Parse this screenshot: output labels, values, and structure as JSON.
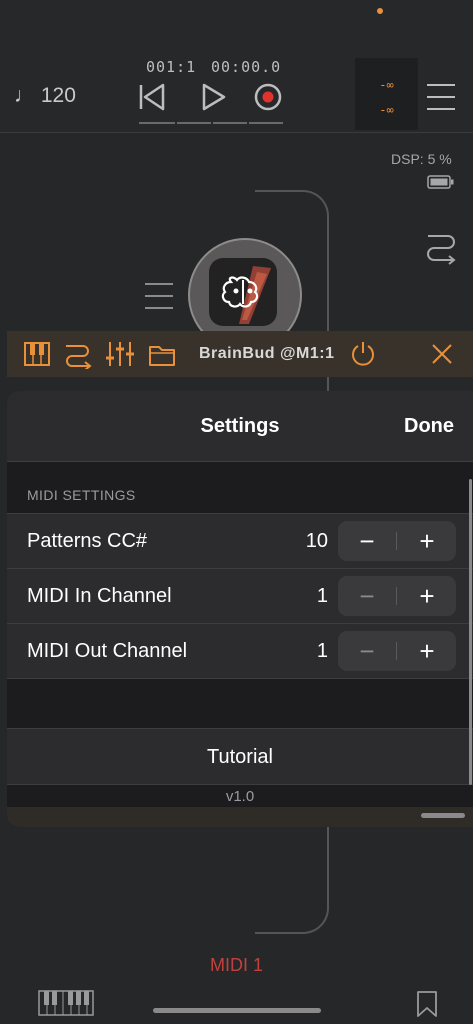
{
  "transport": {
    "tempo_icon": "note-icon",
    "tempo": "120",
    "bar_position": "001:1",
    "time_position": "00:00.0",
    "meter_top": "-∞",
    "meter_bottom": "-∞"
  },
  "status": {
    "dsp_label": "DSP:",
    "dsp_value": "5 %"
  },
  "plugin_bar": {
    "title": "BrainBud @M1:1",
    "accent_color": "#e8903a"
  },
  "settings": {
    "title": "Settings",
    "done_label": "Done",
    "section_header": "MIDI SETTINGS",
    "rows": [
      {
        "label": "Patterns CC#",
        "value": "10",
        "minus": "−",
        "plus": "+"
      },
      {
        "label": "MIDI In Channel",
        "value": "1",
        "minus": "−",
        "plus": "+"
      },
      {
        "label": "MIDI Out Channel",
        "value": "1",
        "minus": "−",
        "plus": "+"
      }
    ],
    "tutorial_label": "Tutorial",
    "version": "v1.0"
  },
  "footer": {
    "track_label": "MIDI 1",
    "track_color": "#c2403d"
  }
}
